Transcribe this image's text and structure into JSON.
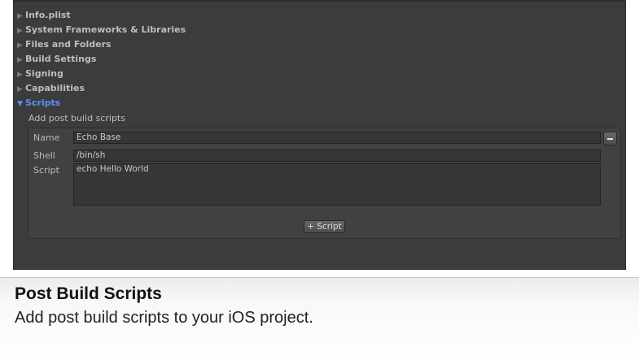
{
  "tree": {
    "items": [
      {
        "label": "Info.plist",
        "expanded": false
      },
      {
        "label": "System Frameworks & Libraries",
        "expanded": false
      },
      {
        "label": "Files and Folders",
        "expanded": false
      },
      {
        "label": "Build Settings",
        "expanded": false
      },
      {
        "label": "Signing",
        "expanded": false
      },
      {
        "label": "Capabilities",
        "expanded": false
      },
      {
        "label": "Scripts",
        "expanded": true
      }
    ],
    "collapsed_glyph": "▶",
    "expanded_glyph": "▼"
  },
  "scripts_section": {
    "subheading": "Add post build scripts",
    "name_label": "Name",
    "name_value": "Echo Base",
    "shell_label": "Shell",
    "shell_value": "/bin/sh",
    "script_label": "Script",
    "script_value": "echo Hello World",
    "add_button_label": "+ Script"
  },
  "caption": {
    "title": "Post Build Scripts",
    "description": "Add post build scripts to your iOS project."
  },
  "colors": {
    "panel_bg": "#3c3c3c",
    "expanded_accent": "#5b8ff9",
    "tree_text": "#bdbdbd"
  }
}
